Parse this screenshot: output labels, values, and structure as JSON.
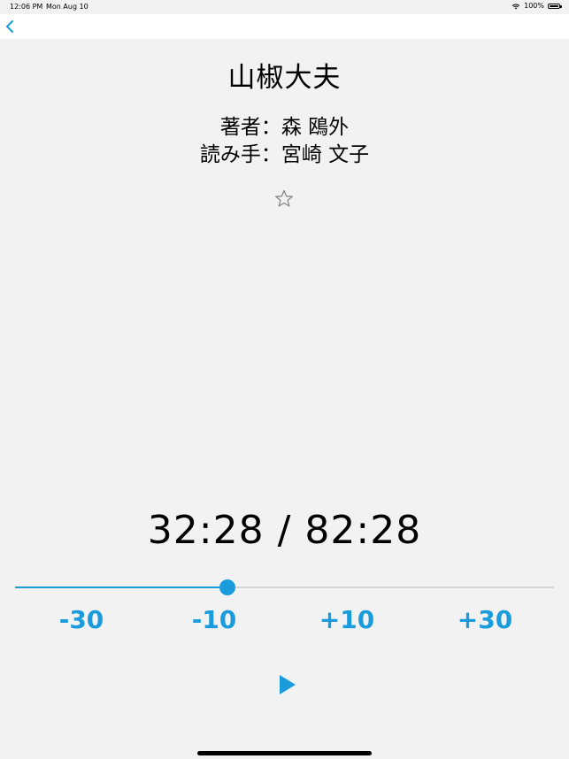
{
  "status_bar": {
    "time": "12:06 PM",
    "date": "Mon Aug 10",
    "battery": "100%"
  },
  "nav": {
    "back_icon": "chevron-left-icon"
  },
  "book": {
    "title": "山椒大夫",
    "author_line": "著者：森 鴎外",
    "reader_line": "読み手：宮崎 文子",
    "favorite_icon": "star-outline-icon"
  },
  "player": {
    "timecode": "32:28 / 82:28",
    "progress_fraction": 0.3937,
    "skip_buttons": [
      "-30",
      "-10",
      "+10",
      "+30"
    ],
    "play_icon": "play-icon"
  },
  "colors": {
    "accent": "#1a9bdc",
    "background": "#f2f2f2",
    "track": "#d4d4d4"
  }
}
